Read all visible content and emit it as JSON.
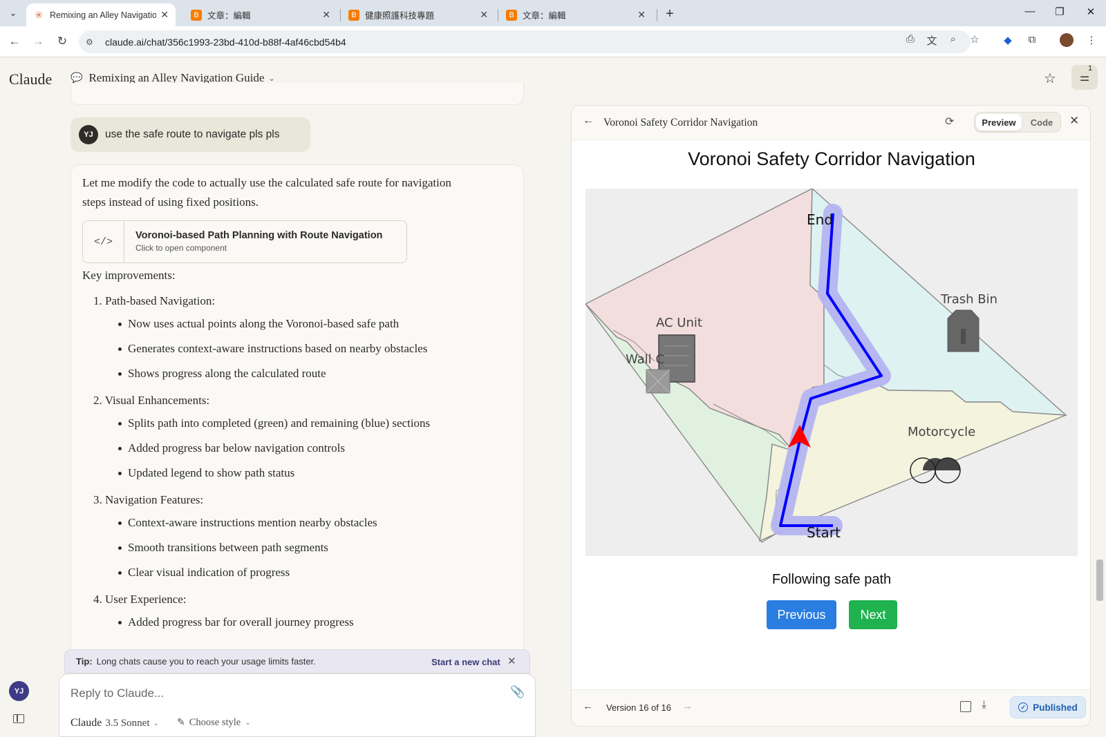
{
  "browser": {
    "tabs": [
      {
        "title": "Remixing an Alley Navigation",
        "icon": "claude-asterisk-icon",
        "color": "#d97757",
        "active": true
      },
      {
        "title": "文章：編輯",
        "icon": "blogger-icon",
        "color": "#f57c00",
        "active": false
      },
      {
        "title": "健康照護科技專題",
        "icon": "blogger-icon",
        "color": "#f57c00",
        "active": false
      },
      {
        "title": "文章：編輯",
        "icon": "blogger-icon",
        "color": "#f57c00",
        "active": false
      }
    ],
    "url": "claude.ai/chat/356c1993-23bd-410d-b88f-4af46cbd54b4"
  },
  "app": {
    "logo": "Claude",
    "chat_title": "Remixing an Alley Navigation Guide",
    "settings_badge": "1"
  },
  "user_message": {
    "initials": "YJ",
    "text": "use the safe route to navigate pls pls"
  },
  "assistant": {
    "intro": "Let me modify the code to actually use the calculated safe route for navigation steps instead of using fixed positions.",
    "artifact": {
      "icon": "</>",
      "name": "Voronoi-based Path Planning with Route Navigation",
      "subtitle": "Click to open component"
    },
    "key_heading": "Key improvements:",
    "points": [
      {
        "title": "1. Path-based Navigation:",
        "bullets": [
          "Now uses actual points along the Voronoi-based safe path",
          "Generates context-aware instructions based on nearby obstacles",
          "Shows progress along the calculated route"
        ]
      },
      {
        "title": "2. Visual Enhancements:",
        "bullets": [
          "Splits path into completed (green) and remaining (blue) sections",
          "Added progress bar below navigation controls",
          "Updated legend to show path status"
        ]
      },
      {
        "title": "3. Navigation Features:",
        "bullets": [
          "Context-aware instructions mention nearby obstacles",
          "Smooth transitions between path segments",
          "Clear visual indication of progress"
        ]
      },
      {
        "title": "4. User Experience:",
        "bullets": [
          "Added progress bar for overall journey progress"
        ]
      }
    ]
  },
  "tip": {
    "label": "Tip:",
    "text": "Long chats cause you to reach your usage limits faster.",
    "link": "Start a new chat"
  },
  "composer": {
    "placeholder": "Reply to Claude...",
    "model": "Claude",
    "model_version": "3.5 Sonnet",
    "style": "Choose style"
  },
  "sidebar": {
    "user_initials": "YJ"
  },
  "panel": {
    "title": "Voronoi Safety Corridor Navigation",
    "view_preview": "Preview",
    "view_code": "Code",
    "viz_title": "Voronoi Safety Corridor Navigation",
    "map_labels": {
      "end": "End",
      "start": "Start",
      "ac_unit": "AC Unit",
      "wall": "Wall C",
      "trash_bin": "Trash Bin",
      "motorcycle": "Motorcycle"
    },
    "nav_status": "Following safe path",
    "prev_label": "Previous",
    "next_label": "Next",
    "version_label": "Version 16 of 16",
    "published_label": "Published",
    "colors": {
      "path": "#0000ff",
      "corridor": "#b4b4f0",
      "heading_arrow": "#ff0000",
      "region_pink": "#f3dede",
      "region_cyan": "#dff2f2",
      "region_yellow": "#f3f3de",
      "region_green": "#e0f2df"
    }
  }
}
